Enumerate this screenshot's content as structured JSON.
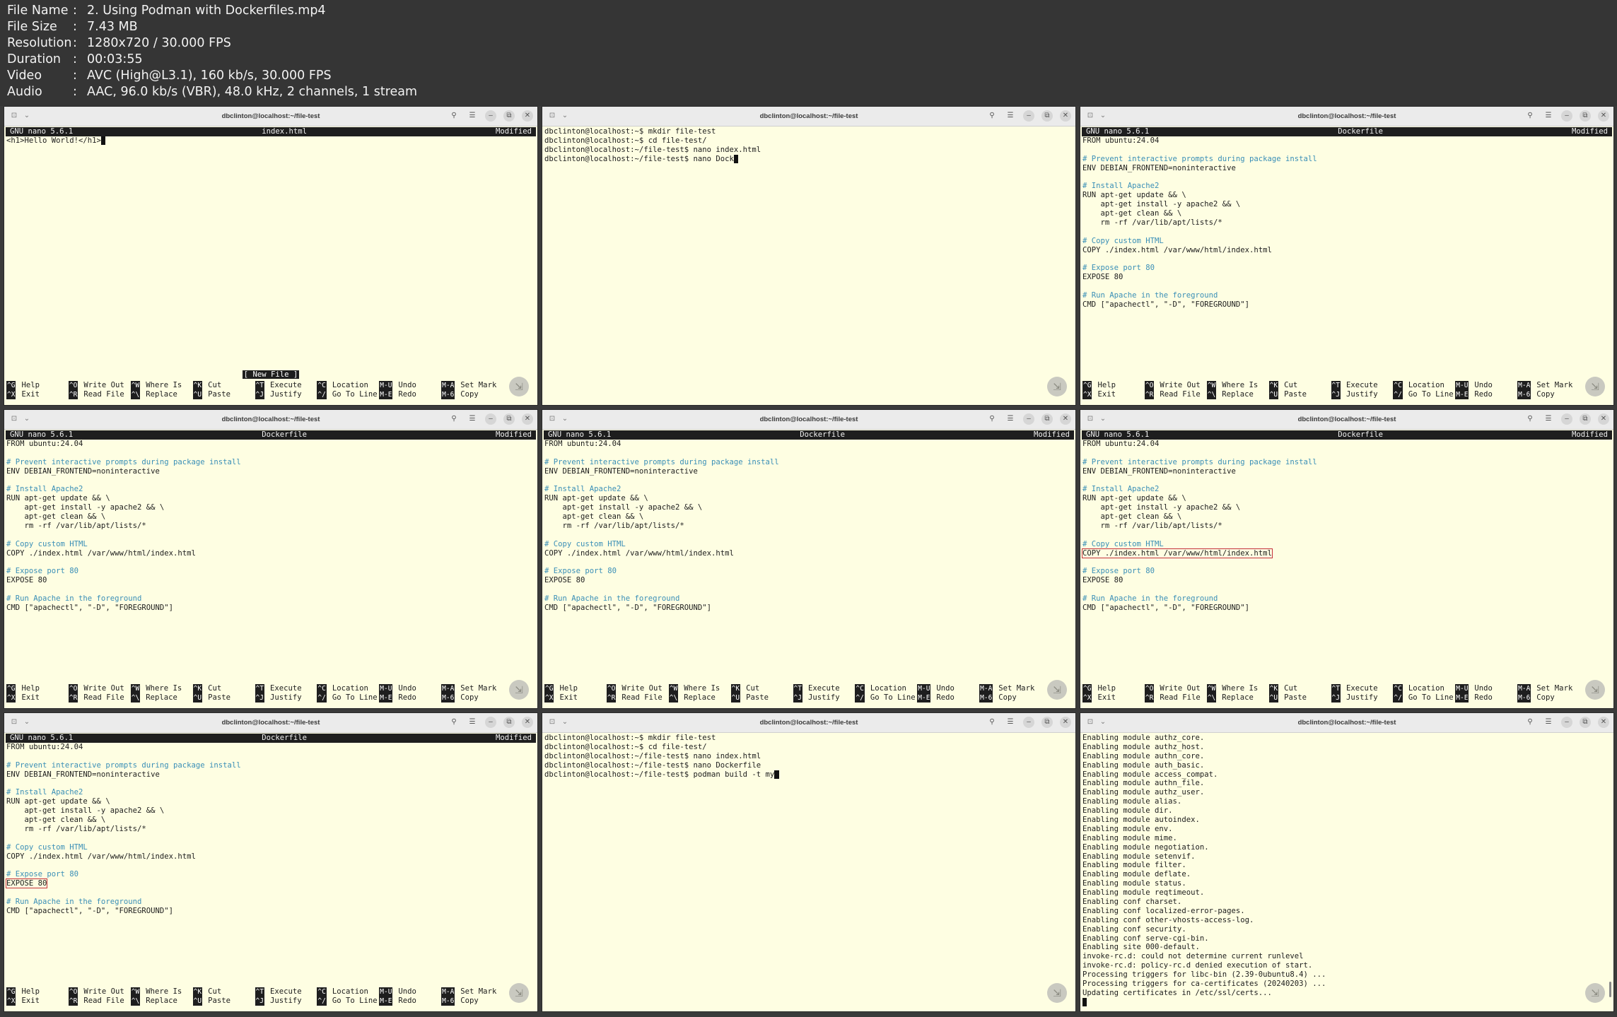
{
  "info": [
    {
      "key": "File Name",
      "value": "2. Using Podman with Dockerfiles.mp4"
    },
    {
      "key": "File Size",
      "value": "7.43 MB"
    },
    {
      "key": "Resolution",
      "value": "1280x720 / 30.000 FPS"
    },
    {
      "key": "Duration",
      "value": "00:03:55"
    },
    {
      "key": "Video",
      "value": "AVC (High@L3.1), 160 kb/s, 30.000 FPS"
    },
    {
      "key": "Audio",
      "value": "AAC, 96.0 kb/s (VBR), 48.0 kHz, 2 channels, 1 stream"
    }
  ],
  "window_title": "dbclinton@localhost:~/file-test",
  "nano": {
    "version": "GNU nano 5.6.1",
    "modified": "Modified",
    "new_file": "[ New File ]",
    "footer": [
      [
        {
          "k": "^G",
          "l": "Help"
        },
        {
          "k": "^O",
          "l": "Write Out"
        },
        {
          "k": "^W",
          "l": "Where Is"
        },
        {
          "k": "^K",
          "l": "Cut"
        },
        {
          "k": "^T",
          "l": "Execute"
        },
        {
          "k": "^C",
          "l": "Location"
        },
        {
          "k": "M-U",
          "l": "Undo"
        },
        {
          "k": "M-A",
          "l": "Set Mark"
        }
      ],
      [
        {
          "k": "^X",
          "l": "Exit"
        },
        {
          "k": "^R",
          "l": "Read File"
        },
        {
          "k": "^\\",
          "l": "Replace"
        },
        {
          "k": "^U",
          "l": "Paste"
        },
        {
          "k": "^J",
          "l": "Justify"
        },
        {
          "k": "^/",
          "l": "Go To Line"
        },
        {
          "k": "M-E",
          "l": "Redo"
        },
        {
          "k": "M-6",
          "l": "Copy"
        }
      ]
    ]
  },
  "dockerfile": [
    {
      "t": "FROM ubuntu:24.04"
    },
    {
      "t": ""
    },
    {
      "t": "# Prevent interactive prompts during package install",
      "c": true
    },
    {
      "t": "ENV DEBIAN_FRONTEND=noninteractive"
    },
    {
      "t": ""
    },
    {
      "t": "# Install Apache2",
      "c": true
    },
    {
      "t": "RUN apt-get update && \\"
    },
    {
      "t": "    apt-get install -y apache2 && \\"
    },
    {
      "t": "    apt-get clean && \\"
    },
    {
      "t": "    rm -rf /var/lib/apt/lists/*"
    },
    {
      "t": ""
    },
    {
      "t": "# Copy custom HTML",
      "c": true
    },
    {
      "t": "COPY ./index.html /var/www/html/index.html"
    },
    {
      "t": ""
    },
    {
      "t": "# Expose port 80",
      "c": true
    },
    {
      "t": "EXPOSE 80"
    },
    {
      "t": ""
    },
    {
      "t": "# Run Apache in the foreground",
      "c": true
    },
    {
      "t": "CMD [\"apachectl\", \"-D\", \"FOREGROUND\"]"
    }
  ],
  "panes": [
    {
      "type": "nano",
      "file": "index.html",
      "lines": [
        {
          "t": "<h1>Hello World!</h1>"
        }
      ],
      "new_file": true
    },
    {
      "type": "shell",
      "lines": [
        "dbclinton@localhost:~$ mkdir file-test",
        "dbclinton@localhost:~$ cd file-test/",
        "dbclinton@localhost:~/file-test$ nano index.html",
        "dbclinton@localhost:~/file-test$ nano Dock"
      ]
    },
    {
      "type": "nano",
      "file": "Dockerfile",
      "doc": true
    },
    {
      "type": "nano",
      "file": "Dockerfile",
      "doc": true
    },
    {
      "type": "nano",
      "file": "Dockerfile",
      "doc": true
    },
    {
      "type": "nano",
      "file": "Dockerfile",
      "doc": true,
      "highlight": 12
    },
    {
      "type": "nano",
      "file": "Dockerfile",
      "doc": true,
      "highlight": 15
    },
    {
      "type": "shell",
      "lines": [
        "dbclinton@localhost:~$ mkdir file-test",
        "dbclinton@localhost:~$ cd file-test/",
        "dbclinton@localhost:~/file-test$ nano index.html",
        "dbclinton@localhost:~/file-test$ nano Dockerfile",
        "dbclinton@localhost:~/file-test$ podman build -t my"
      ]
    },
    {
      "type": "log",
      "lines": [
        "Enabling module authz_core.",
        "Enabling module authz_host.",
        "Enabling module authn_core.",
        "Enabling module auth_basic.",
        "Enabling module access_compat.",
        "Enabling module authn_file.",
        "Enabling module authz_user.",
        "Enabling module alias.",
        "Enabling module dir.",
        "Enabling module autoindex.",
        "Enabling module env.",
        "Enabling module mime.",
        "Enabling module negotiation.",
        "Enabling module setenvif.",
        "Enabling module filter.",
        "Enabling module deflate.",
        "Enabling module status.",
        "Enabling module reqtimeout.",
        "Enabling conf charset.",
        "Enabling conf localized-error-pages.",
        "Enabling conf other-vhosts-access-log.",
        "Enabling conf security.",
        "Enabling conf serve-cgi-bin.",
        "Enabling site 000-default.",
        "invoke-rc.d: could not determine current runlevel",
        "invoke-rc.d: policy-rc.d denied execution of start.",
        "Processing triggers for libc-bin (2.39-0ubuntu8.4) ...",
        "Processing triggers for ca-certificates (20240203) ...",
        "Updating certificates in /etc/ssl/certs..."
      ]
    }
  ]
}
